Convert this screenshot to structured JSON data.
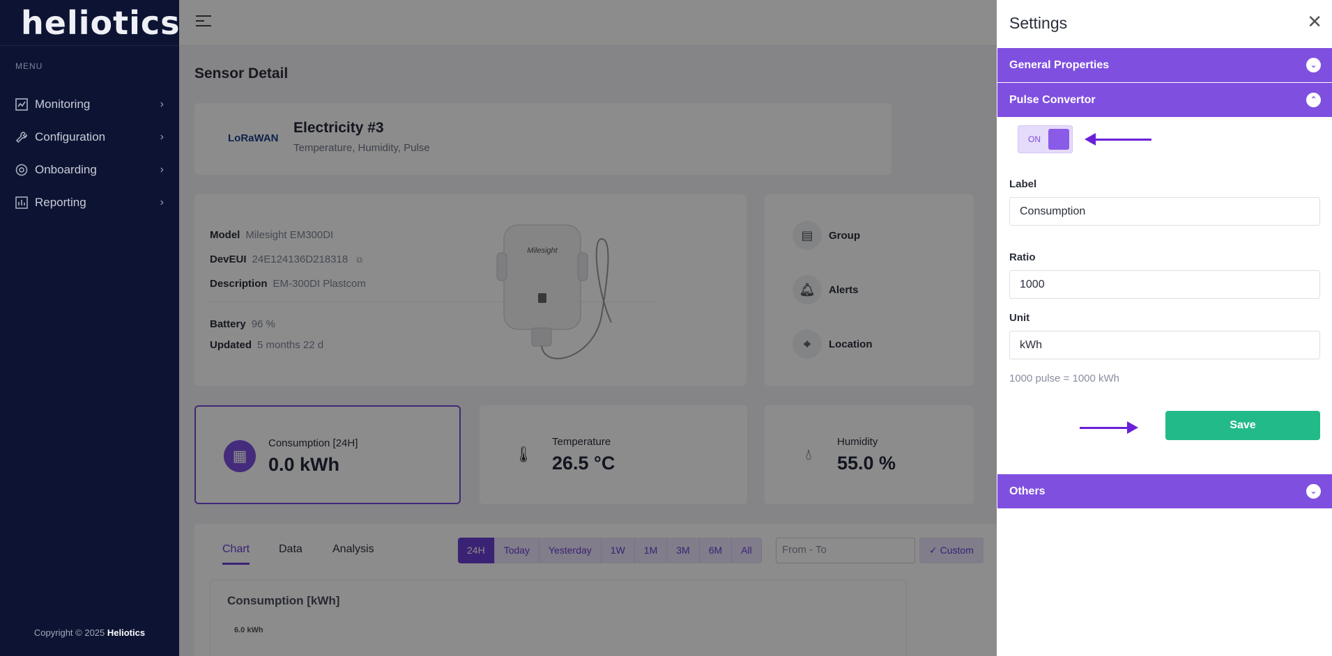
{
  "brand": {
    "logo_text": "heliotics"
  },
  "sidebar": {
    "menu_label": "MENU",
    "items": [
      {
        "label": "Monitoring",
        "icon": "chart-icon"
      },
      {
        "label": "Configuration",
        "icon": "wrench-icon"
      },
      {
        "label": "Onboarding",
        "icon": "onboarding-icon"
      },
      {
        "label": "Reporting",
        "icon": "report-icon"
      }
    ],
    "copyright_prefix": "Copyright © 2025",
    "copyright_brand": "Heliotics"
  },
  "page": {
    "title": "Sensor Detail"
  },
  "device": {
    "network_logo": "LoRaWAN",
    "name": "Electricity #3",
    "types": "Temperature, Humidity, Pulse",
    "info": {
      "model_label": "Model",
      "model_value": "Milesight EM300DI",
      "deveui_label": "DevEUI",
      "deveui_value": "24E124136D218318",
      "description_label": "Description",
      "description_value": "EM-300DI Plastcom",
      "battery_label": "Battery",
      "battery_value": "96 %",
      "updated_label": "Updated",
      "updated_value": "5 months 22 d"
    },
    "device_brand": "Milesight",
    "side_items": [
      "Group",
      "Alerts",
      "Location"
    ]
  },
  "metrics": [
    {
      "label": "Consumption [24H]",
      "value": "0.0 kWh",
      "icon": "calculator-icon"
    },
    {
      "label": "Temperature",
      "value": "26.5 °C",
      "icon": "thermometer-icon"
    },
    {
      "label": "Humidity",
      "value": "55.0 %",
      "icon": "droplet-icon"
    }
  ],
  "chart_section": {
    "tabs": [
      "Chart",
      "Data",
      "Analysis"
    ],
    "ranges": [
      "24H",
      "Today",
      "Yesterday",
      "1W",
      "1M",
      "3M",
      "6M",
      "All"
    ],
    "date_placeholder": "From - To",
    "custom_label": "✓ Custom",
    "chart_title": "Consumption [kWh]",
    "y_tick_top": "6.0 kWh"
  },
  "settings": {
    "title": "Settings",
    "sections": {
      "general": "General Properties",
      "pulse": "Pulse Convertor",
      "others": "Others"
    },
    "toggle_text": "ON",
    "label_field": {
      "label": "Label",
      "value": "Consumption"
    },
    "ratio_field": {
      "label": "Ratio",
      "value": "1000"
    },
    "unit_field": {
      "label": "Unit",
      "value": "kWh"
    },
    "hint": "1000 pulse = 1000 kWh",
    "save_label": "Save"
  },
  "colors": {
    "accent": "#7f4fe0",
    "save": "#23ba8a",
    "sidebar": "#0d1433"
  }
}
